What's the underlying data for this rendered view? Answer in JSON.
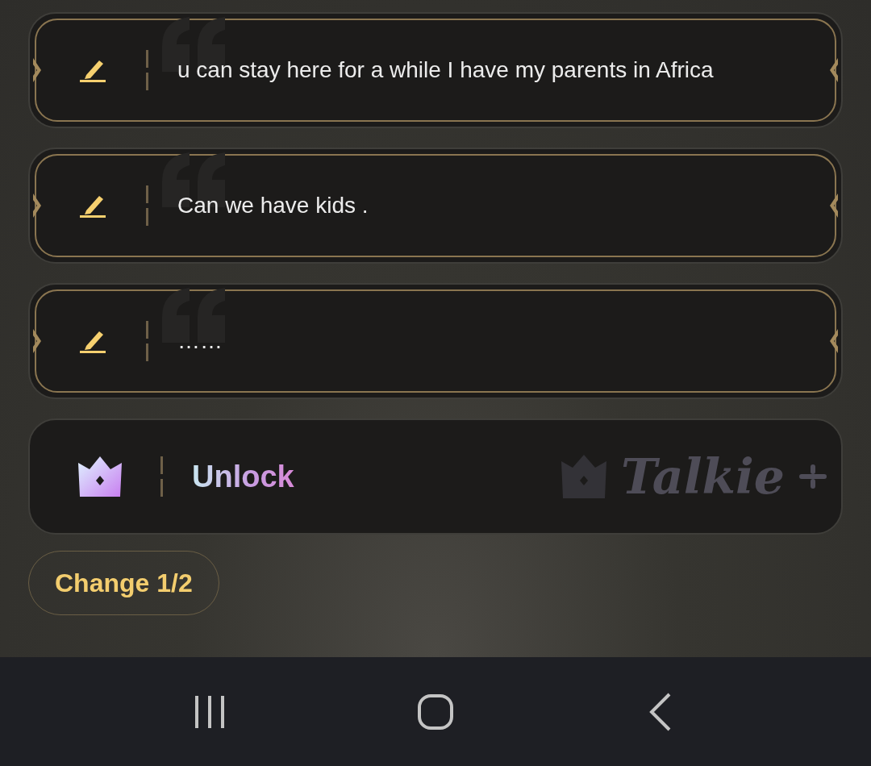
{
  "replies": [
    {
      "kind": "reply",
      "text": "u can stay here for a while I have my parents in Africa"
    },
    {
      "kind": "reply",
      "text": "Can we have kids ."
    },
    {
      "kind": "reply",
      "text": "……"
    },
    {
      "kind": "unlock",
      "text": "Unlock",
      "brand": "Talkie"
    }
  ],
  "change_button": "Change 1/2"
}
